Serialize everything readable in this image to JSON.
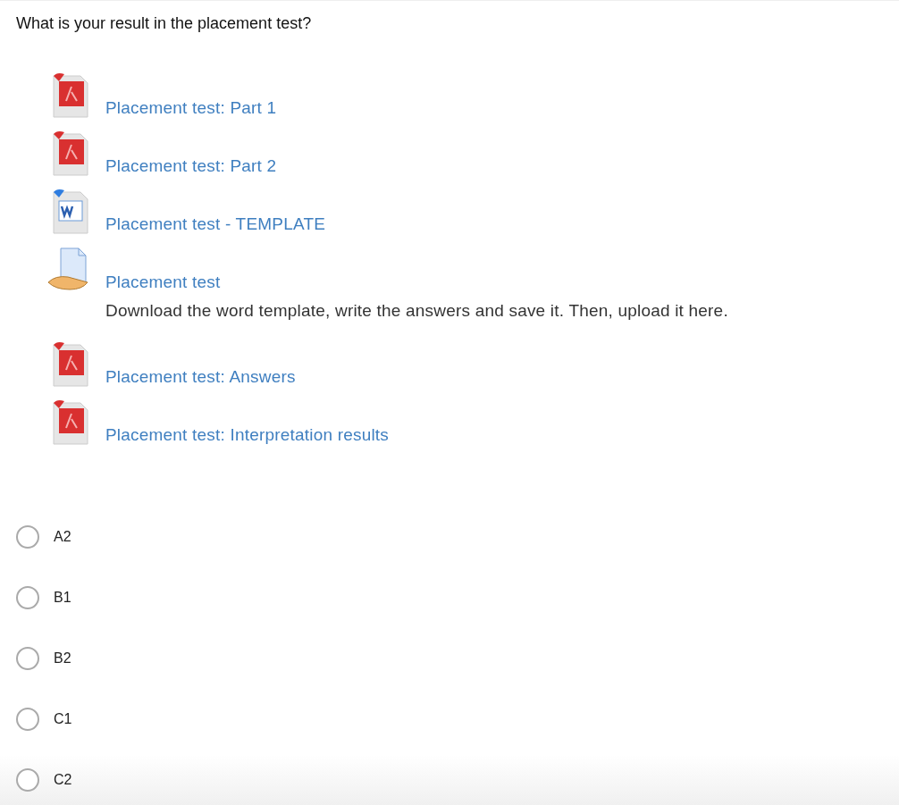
{
  "question": "What is your result in the placement test?",
  "resources": [
    {
      "kind": "pdf",
      "label": "Placement test: Part 1"
    },
    {
      "kind": "pdf",
      "label": "Placement test: Part 2"
    },
    {
      "kind": "word",
      "label": "Placement test - TEMPLATE"
    },
    {
      "kind": "assignment",
      "label": "Placement test",
      "description": "Download the word template, write the answers and save it. Then, upload it here."
    },
    {
      "kind": "pdf",
      "label": "Placement test: Answers"
    },
    {
      "kind": "pdf",
      "label": "Placement test: Interpretation results"
    }
  ],
  "options": [
    {
      "label": "A2",
      "selected": false
    },
    {
      "label": "B1",
      "selected": false
    },
    {
      "label": "B2",
      "selected": false
    },
    {
      "label": "C1",
      "selected": false
    },
    {
      "label": "C2",
      "selected": false
    }
  ]
}
